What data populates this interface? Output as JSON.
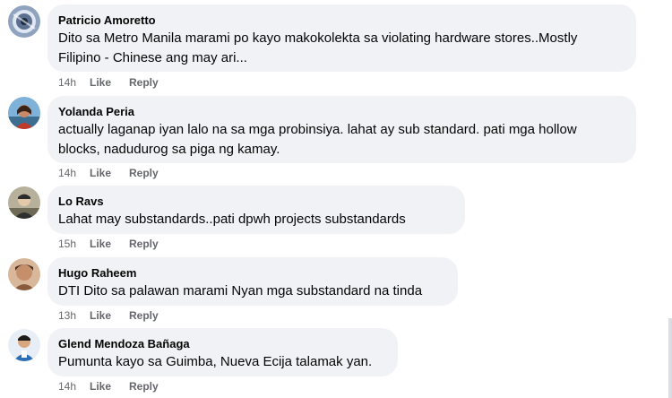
{
  "comments": [
    {
      "author": "Patricio Amoretto",
      "text": "Dito sa Metro Manila marami po kayo makokolekta sa violating hardware stores..Mostly\nFilipino - Chinese ang may ari...",
      "time": "14h",
      "like_label": "Like",
      "reply_label": "Reply"
    },
    {
      "author": "Yolanda Peria",
      "text": "actually laganap iyan lalo na sa mga probinsiya. lahat ay sub standard. pati mga hollow\nblocks, nadudurog sa piga ng kamay.",
      "time": "14h",
      "like_label": "Like",
      "reply_label": "Reply"
    },
    {
      "author": "Lo Ravs",
      "text": "Lahat may substandards..pati dpwh projects substandards",
      "time": "15h",
      "like_label": "Like",
      "reply_label": "Reply"
    },
    {
      "author": "Hugo Raheem",
      "text": "DTI Dito sa palawan marami Nyan mga substandard na tinda",
      "time": "13h",
      "like_label": "Like",
      "reply_label": "Reply"
    },
    {
      "author": "Glend Mendoza Bañaga",
      "text": "Pumunta kayo sa Guimba, Nueva Ecija talamak yan.",
      "time": "14h",
      "like_label": "Like",
      "reply_label": "Reply"
    }
  ]
}
